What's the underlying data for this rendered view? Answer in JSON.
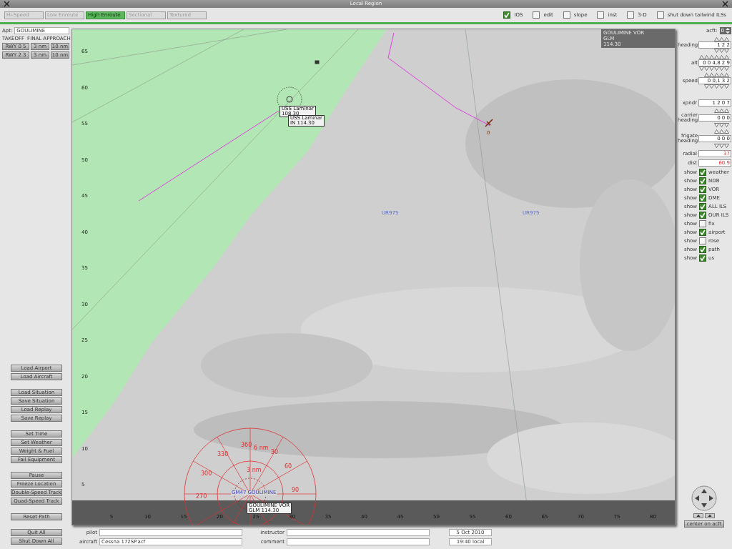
{
  "window": {
    "title": "Local Region"
  },
  "tabs": [
    {
      "label": "Hi-Speed",
      "selected": false
    },
    {
      "label": "Low Enroute",
      "selected": false
    },
    {
      "label": "High Enroute",
      "selected": true
    },
    {
      "label": "Sectional",
      "selected": false
    },
    {
      "label": "Textured",
      "selected": false
    }
  ],
  "options": [
    {
      "label": "IOS",
      "checked": true
    },
    {
      "label": "edit",
      "checked": false
    },
    {
      "label": "slope",
      "checked": false
    },
    {
      "label": "inst",
      "checked": false
    },
    {
      "label": "3-D",
      "checked": false
    },
    {
      "label": "shut down tailwind ILSs",
      "checked": false
    }
  ],
  "airport": {
    "label": "Apt:",
    "value": "GOULIMINE"
  },
  "runway_headers": [
    "TAKEOFF",
    "FINAL APPROACH"
  ],
  "runways": [
    {
      "name": "RWY 0 5",
      "short": "3 nm",
      "long": "10 nm"
    },
    {
      "name": "RWY 2 3",
      "short": "3 nm",
      "long": "10 nm"
    }
  ],
  "button_groups": [
    [
      "Load Airport",
      "Load Aircraft"
    ],
    [
      "Load Situation",
      "Save Situation",
      "Load Replay",
      "Save Replay"
    ],
    [
      "Set Time",
      "Set Weather",
      "Weight & Fuel",
      "Fail Equipment"
    ],
    [
      "Pause",
      "Freeze Location",
      "Double-Speed Track",
      "Quad-Speed Track"
    ],
    [
      "Reset Path"
    ],
    [
      "Quit All",
      "Shut Down All"
    ]
  ],
  "map": {
    "y_ticks": [
      "65",
      "60",
      "55",
      "50",
      "45",
      "40",
      "35",
      "30",
      "25",
      "20",
      "15",
      "10",
      "5"
    ],
    "x_ticks": [
      "5",
      "10",
      "15",
      "20",
      "25",
      "30",
      "35",
      "40",
      "45",
      "50",
      "55",
      "60",
      "65",
      "70",
      "75",
      "80"
    ],
    "labels": [
      {
        "kind": "info",
        "lines": [
          "GOULIMINE VOR",
          "GLM",
          "114.30"
        ]
      },
      {
        "kind": "tag",
        "lines": [
          "USS Laminar",
          "108.30"
        ]
      },
      {
        "kind": "tag",
        "lines": [
          "USS Laminar",
          "IN 114.30"
        ]
      },
      {
        "kind": "airway",
        "lines": [
          "UR975"
        ]
      },
      {
        "kind": "airway",
        "lines": [
          "UR975"
        ]
      },
      {
        "kind": "aircraft",
        "lines": [
          "0"
        ]
      },
      {
        "kind": "rose",
        "lines": [
          "360"
        ]
      },
      {
        "kind": "rose",
        "lines": [
          "6 nm"
        ]
      },
      {
        "kind": "rose",
        "lines": [
          "30"
        ]
      },
      {
        "kind": "rose",
        "lines": [
          "330"
        ]
      },
      {
        "kind": "rose",
        "lines": [
          "60"
        ]
      },
      {
        "kind": "rose",
        "lines": [
          "3 nm"
        ]
      },
      {
        "kind": "rose",
        "lines": [
          "300"
        ]
      },
      {
        "kind": "rose",
        "lines": [
          "90"
        ]
      },
      {
        "kind": "rose",
        "lines": [
          "270"
        ]
      },
      {
        "kind": "airport",
        "lines": [
          "GM47 GOULIMINE"
        ]
      },
      {
        "kind": "tag",
        "lines": [
          "GOULIMINE VOR",
          "GLM 114.30"
        ]
      }
    ]
  },
  "aircraft_select": {
    "label": "acft:",
    "value": "0"
  },
  "controls": [
    {
      "kind": "spin",
      "label": "heading",
      "value": "1 2 2"
    },
    {
      "kind": "spin",
      "label": "alt",
      "value": "0 0 4,8 2 9"
    },
    {
      "kind": "spin",
      "label": "speed",
      "value": "0 0,1 3 2"
    },
    {
      "kind": "field",
      "label": "xpndr",
      "value": "1 2 0 7"
    },
    {
      "kind": "spin",
      "label": "carrier heading",
      "value": "0 0 0"
    },
    {
      "kind": "spin",
      "label": "frigate heading",
      "value": "0 0 0"
    },
    {
      "kind": "reading",
      "label": "radial",
      "value": "37"
    },
    {
      "kind": "reading",
      "label": "dist",
      "value": "60.9"
    }
  ],
  "layers": [
    {
      "prefix": "show",
      "label": "weather",
      "checked": true
    },
    {
      "prefix": "show",
      "label": "NDB",
      "checked": true
    },
    {
      "prefix": "show",
      "label": "VOR",
      "checked": true
    },
    {
      "prefix": "show",
      "label": "DME",
      "checked": true
    },
    {
      "prefix": "show",
      "label": "ALL ILS",
      "checked": true
    },
    {
      "prefix": "show",
      "label": "OUR ILS",
      "checked": true
    },
    {
      "prefix": "show",
      "label": "fix",
      "checked": false
    },
    {
      "prefix": "show",
      "label": "airport",
      "checked": true
    },
    {
      "prefix": "show",
      "label": "rose",
      "checked": false
    },
    {
      "prefix": "show",
      "label": "path",
      "checked": true
    },
    {
      "prefix": "show",
      "label": "us",
      "checked": true
    }
  ],
  "center_button": "center on acft",
  "footer": {
    "pilot": {
      "label": "pilot"
    },
    "instructor": {
      "label": "instructor"
    },
    "date": "5 Oct 2010",
    "aircraft": {
      "label": "aircraft",
      "value": "Cessna 172SP.acf"
    },
    "comment": {
      "label": "comment"
    },
    "time": "19:40 local"
  }
}
